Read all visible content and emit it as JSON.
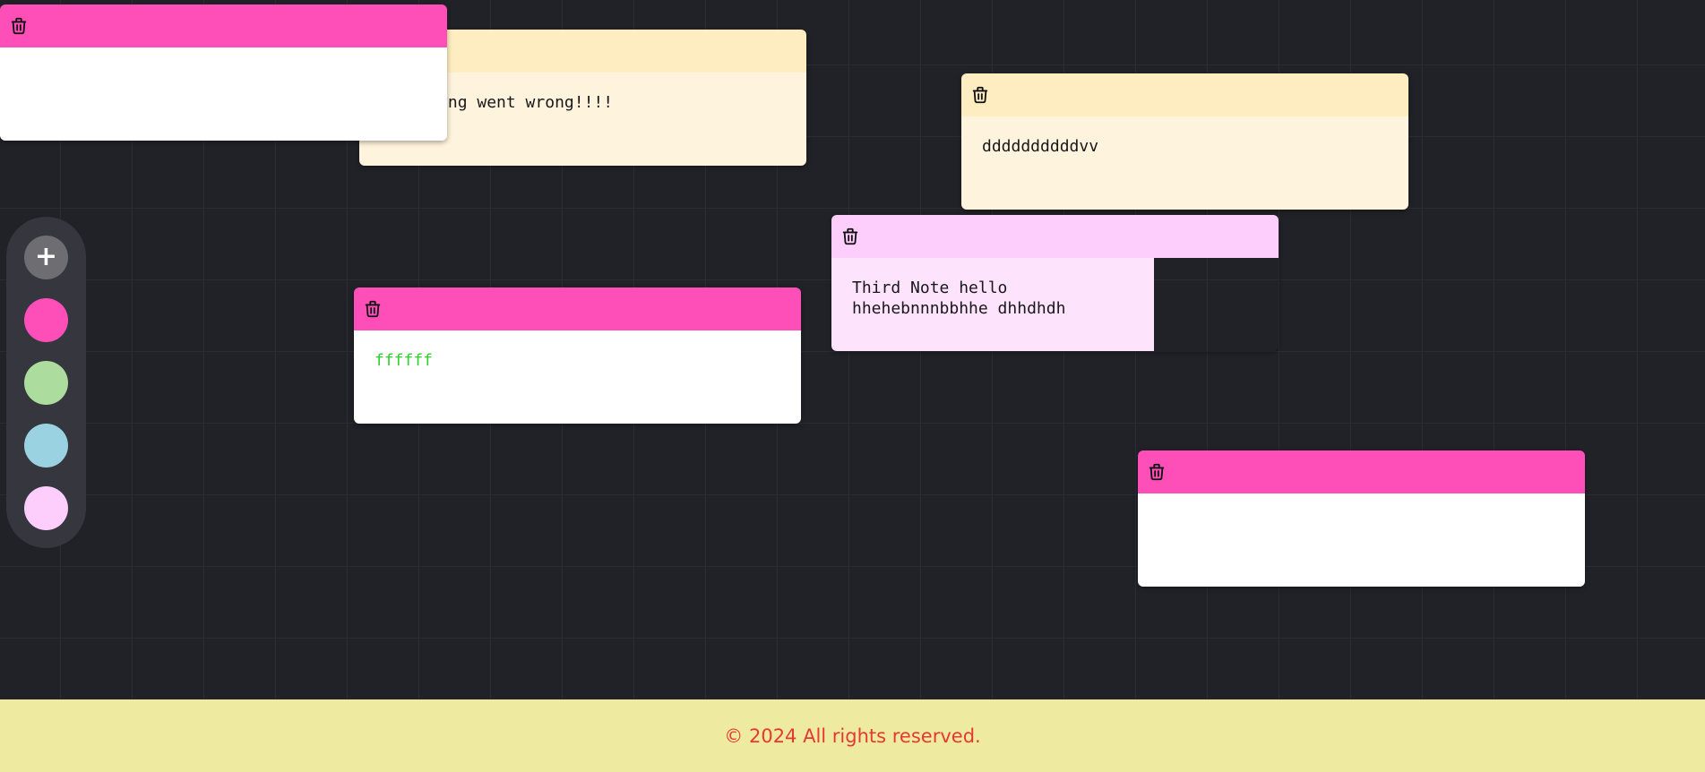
{
  "notes": [
    {
      "id": "note-2",
      "theme": "yellow",
      "body": "Something went wrong!!!!",
      "body_color": "#18181b"
    },
    {
      "id": "note-1",
      "theme": "pink",
      "body": "",
      "body_color": "#18181b"
    },
    {
      "id": "note-3",
      "theme": "yellow",
      "body": "ddddddddddvv",
      "body_color": "#18181b"
    },
    {
      "id": "note-4",
      "theme": "lilac",
      "body": "Third Note hello hhehebnnnbbhhe dhhdhdh",
      "body_color": "#18181b"
    },
    {
      "id": "note-5",
      "theme": "pink",
      "body": "ffffff",
      "body_color": "#2fd12f"
    },
    {
      "id": "note-6",
      "theme": "pink",
      "body": "",
      "body_color": "#18181b"
    }
  ],
  "note_icon": "trash-icon",
  "controls": {
    "add_label": "+",
    "add_icon": "plus-icon",
    "colors": [
      {
        "name": "pink",
        "hex": "#fe4fb9"
      },
      {
        "name": "green",
        "hex": "#addc9f"
      },
      {
        "name": "blue",
        "hex": "#9bd2e1"
      },
      {
        "name": "lilac",
        "hex": "#fdcdfb"
      }
    ]
  },
  "footer": {
    "text": "© 2024 All rights reserved."
  },
  "colors": {
    "background": "#212228",
    "footer_bg": "#eeeaa0",
    "footer_text": "#e53935"
  }
}
